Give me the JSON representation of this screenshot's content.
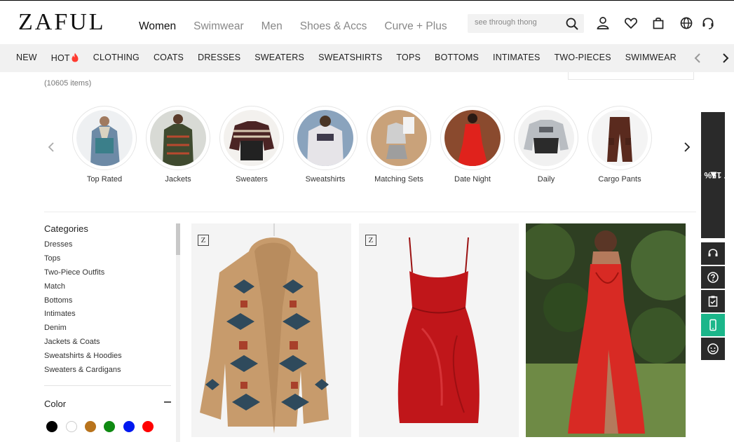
{
  "brand": {
    "logo": "ZAFUL"
  },
  "main_nav": [
    "Women",
    "Swimwear",
    "Men",
    "Shoes & Accs",
    "Curve + Plus"
  ],
  "search": {
    "placeholder": "see through thong"
  },
  "header_icons": [
    "search-icon",
    "user-icon",
    "heart-icon",
    "bag-icon",
    "globe-icon",
    "headset-icon"
  ],
  "category_bar": [
    "NEW",
    "HOT",
    "CLOTHING",
    "COATS",
    "DRESSES",
    "SWEATERS",
    "SWEATSHIRTS",
    "TOPS",
    "BOTTOMS",
    "INTIMATES",
    "TWO-PIECES",
    "SWIMWEAR"
  ],
  "items_count": "(10605 items)",
  "circles": [
    "Top Rated",
    "Jackets",
    "Sweaters",
    "Sweatshirts",
    "Matching Sets",
    "Date Night",
    "Daily",
    "Cargo Pants"
  ],
  "sidebar": {
    "categories_title": "Categories",
    "categories": [
      "Dresses",
      "Tops",
      "Two-Piece Outfits",
      "Match",
      "Bottoms",
      "Intimates",
      "Denim",
      "Jackets & Coats",
      "Sweatshirts & Hoodies",
      "Sweaters & Cardigans"
    ],
    "color_title": "Color",
    "colors": [
      "#000000",
      "#ffffff",
      "#b8731c",
      "#0f8a12",
      "#0018f0",
      "#ff0000"
    ]
  },
  "promo": {
    "label": "GET 15% OFF"
  },
  "side_tools": [
    "headset-icon",
    "help-icon",
    "checklist-icon",
    "mobile-icon",
    "face-icon"
  ],
  "colors": {
    "accent_green": "#1bb68a",
    "dark": "#2a2a2a",
    "hot": "#ff3b30"
  }
}
